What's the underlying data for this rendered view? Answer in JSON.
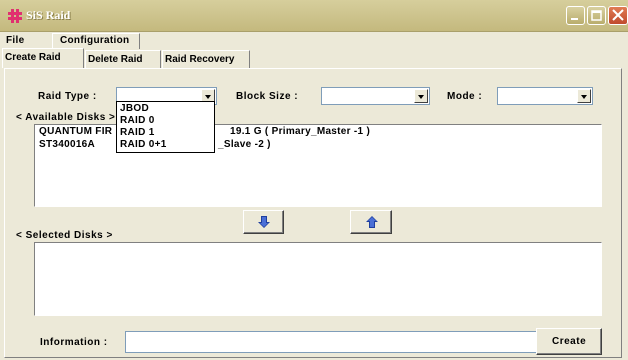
{
  "window": {
    "title": "SiS Raid"
  },
  "menubar": {
    "file": "File",
    "configuration": "Configuration"
  },
  "tabs": [
    {
      "label": "Create Raid"
    },
    {
      "label": "Delete Raid"
    },
    {
      "label": "Raid Recovery"
    }
  ],
  "form": {
    "raid_type_label": "Raid Type :",
    "raid_type_value": "",
    "block_size_label": "Block Size :",
    "block_size_value": "",
    "mode_label": "Mode :",
    "mode_value": ""
  },
  "raid_type_dropdown": {
    "options": [
      "JBOD",
      "RAID 0",
      "RAID 1",
      "RAID 0+1"
    ]
  },
  "available_disks": {
    "label": "< Available Disks >",
    "rows": [
      {
        "name": "QUANTUM FIR",
        "info": "19.1 G   ( Primary_Master -1 )"
      },
      {
        "name": "ST340016A",
        "info": "_Slave -2 )"
      }
    ]
  },
  "selected_disks": {
    "label": "< Selected Disks >"
  },
  "information": {
    "label": "Information :",
    "value": ""
  },
  "create_button": {
    "label": "Create"
  },
  "icons": {
    "move_down": "arrow-down-icon",
    "move_up": "arrow-up-icon"
  },
  "colors": {
    "titlebar": "#c4b97e",
    "close_button": "#c04a2c",
    "arrow_blue": "#1f3f9f",
    "window_bg": "#ece9d8"
  }
}
